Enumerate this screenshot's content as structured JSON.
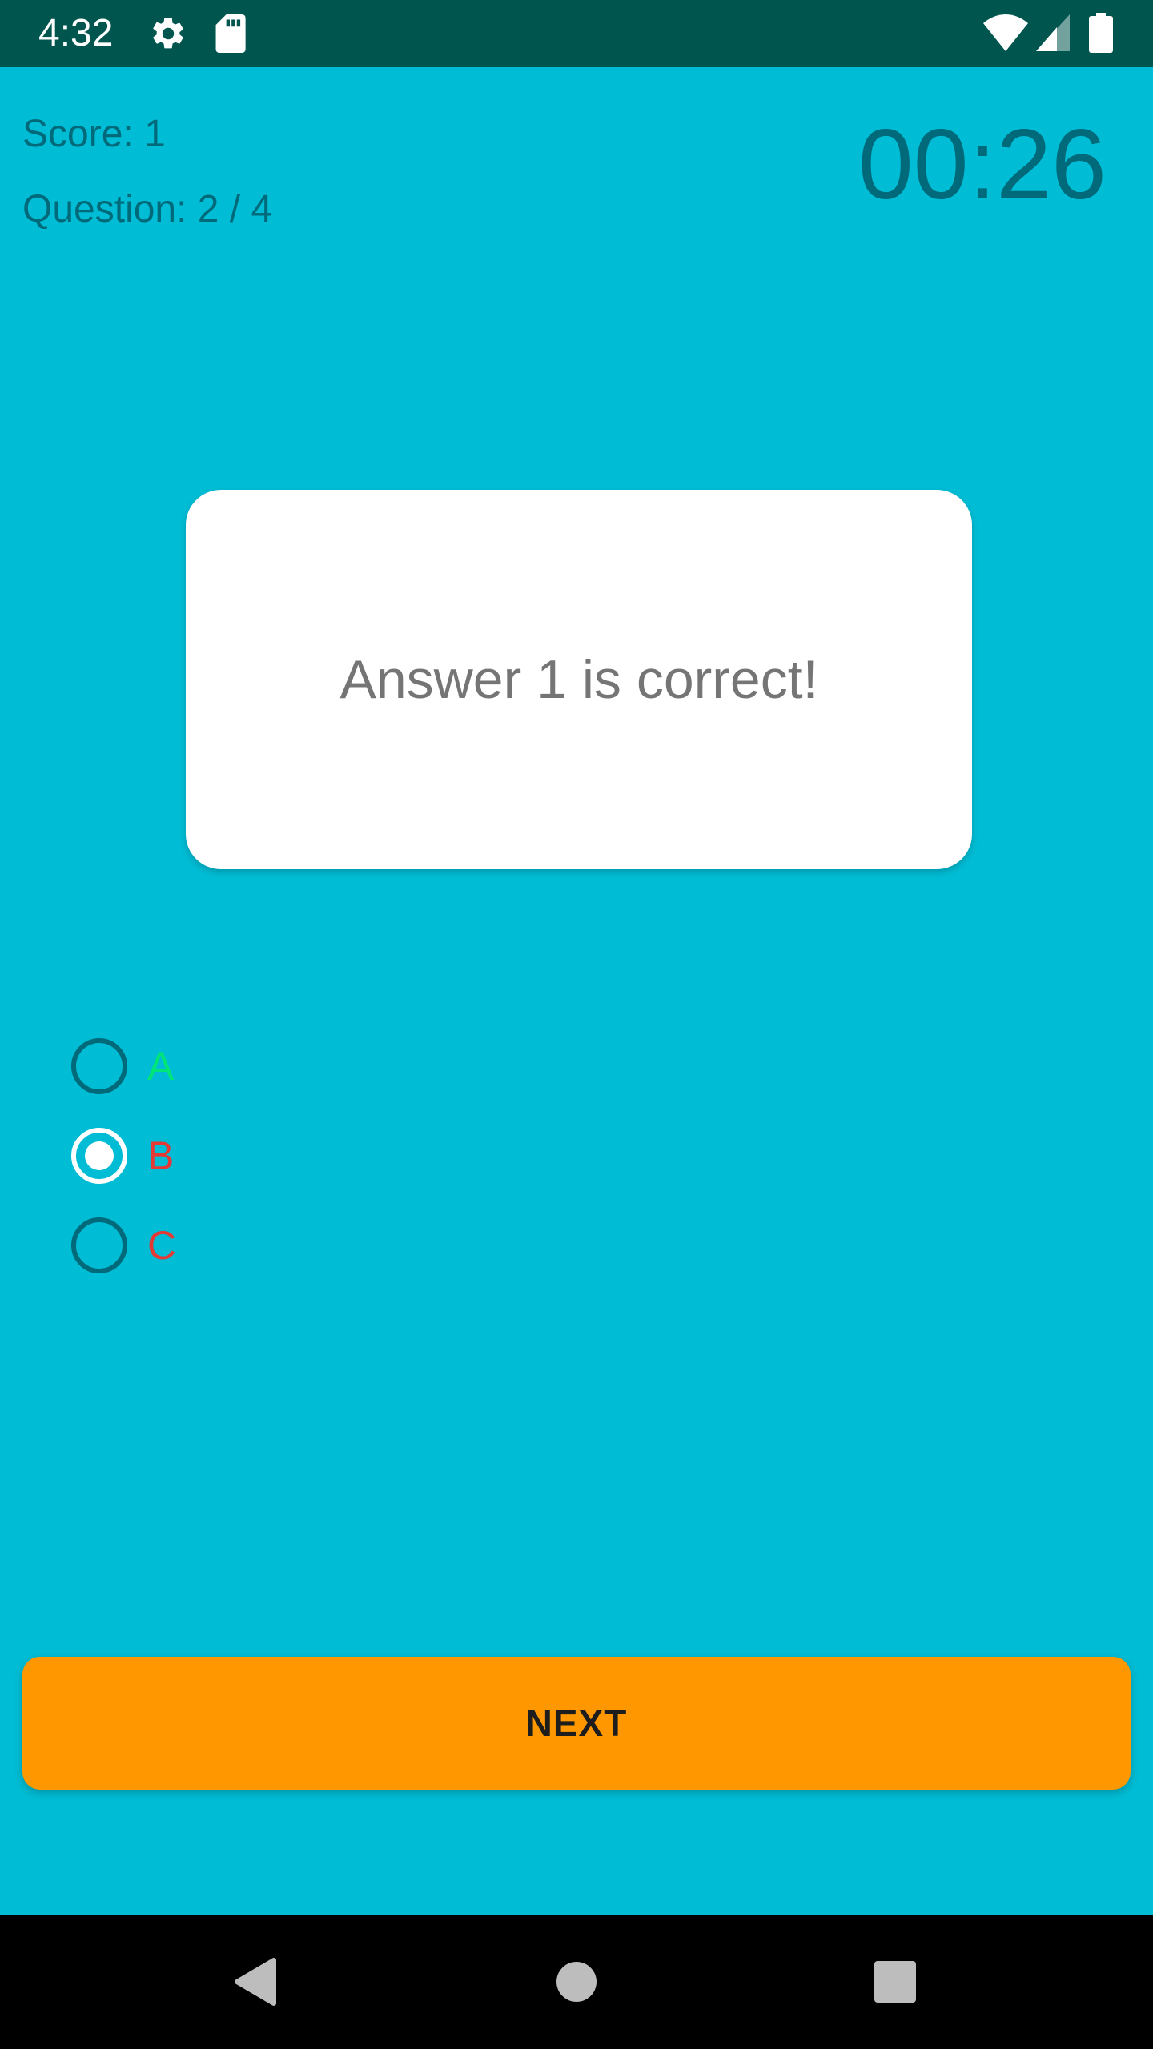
{
  "status_bar": {
    "time": "4:32",
    "icons": [
      "settings-icon",
      "sd-card-icon",
      "wifi-icon",
      "signal-icon",
      "battery-icon"
    ]
  },
  "quiz": {
    "score_text": "Score: 1",
    "question_text_counter": "Question: 2 / 4",
    "timer": "00:26",
    "question": "Answer 1 is correct!",
    "options": [
      {
        "label": "A",
        "selected": false,
        "color": "#00E676"
      },
      {
        "label": "B",
        "selected": true,
        "color": "#E53935"
      },
      {
        "label": "C",
        "selected": false,
        "color": "#E53935"
      }
    ],
    "next_label": "NEXT"
  },
  "colors": {
    "background": "#00BCD4",
    "status_bar": "#00564F",
    "text_dark_teal": "#00697A",
    "button": "#FF9800",
    "correct": "#00E676",
    "wrong": "#E53935"
  },
  "nav_bar": {
    "icons": [
      "back-icon",
      "home-icon",
      "recents-icon"
    ]
  }
}
